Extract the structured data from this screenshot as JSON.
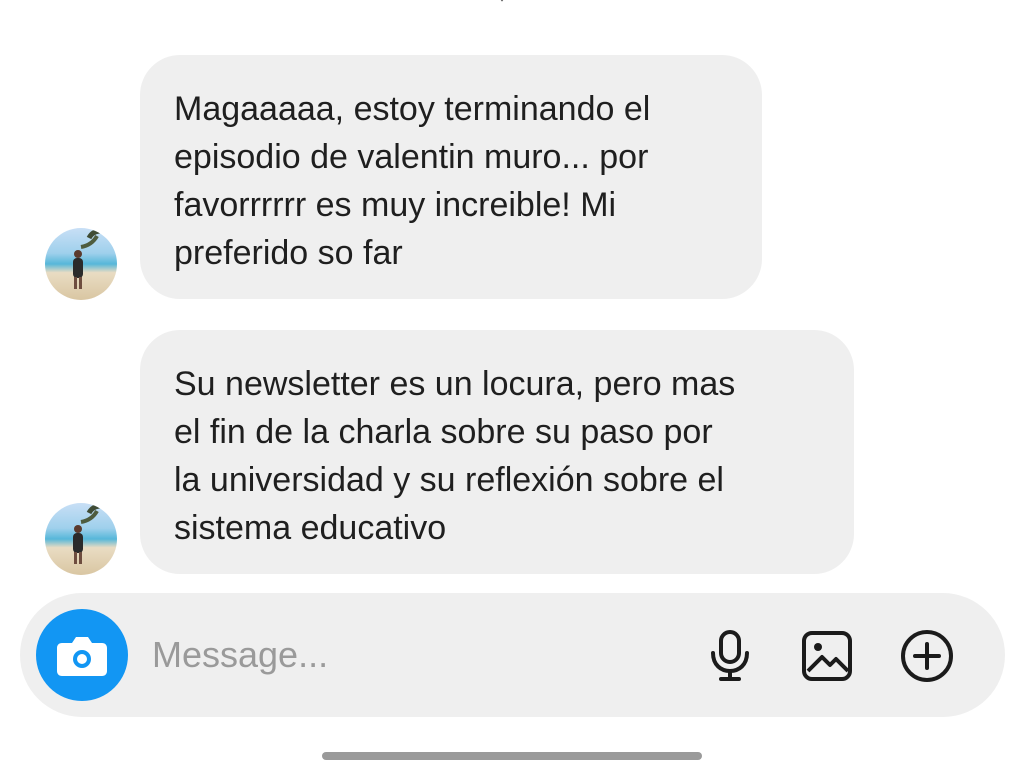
{
  "messages": [
    {
      "sender": "other",
      "text": "Magaaaaa, estoy terminando el\nepisodio de valentin muro... por\nfavorrrrrr es muy increible! Mi\npreferido so far"
    },
    {
      "sender": "other",
      "text": "Su newsletter es un locura, pero mas\nel fin de la charla sobre su paso por\nla universidad y su reflexión sobre el\nsistema educativo"
    }
  ],
  "composer": {
    "placeholder": "Message...",
    "value": "",
    "icons": [
      "camera-icon",
      "microphone-icon",
      "gallery-icon",
      "add-icon"
    ],
    "accent_color": "#1296f3"
  },
  "theme": {
    "bubble_color": "#efefef",
    "composer_color": "#efefef"
  }
}
